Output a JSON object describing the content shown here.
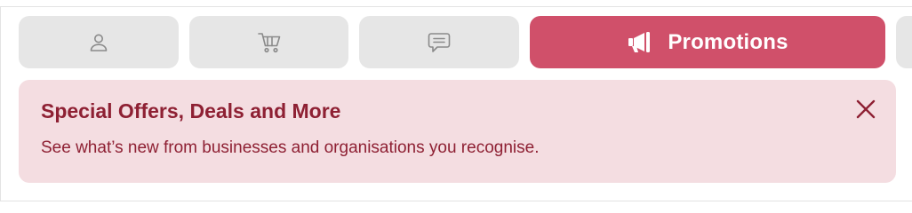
{
  "tabs": [
    {
      "icon": "person-icon",
      "label": ""
    },
    {
      "icon": "cart-icon",
      "label": ""
    },
    {
      "icon": "chat-bubble-icon",
      "label": ""
    },
    {
      "icon": "megaphone-icon",
      "label": "Promotions",
      "selected": true
    }
  ],
  "banner": {
    "title": "Special Offers, Deals and More",
    "text": "See what’s new from businesses and organisations you recognise.",
    "close_icon": "close-icon"
  },
  "colors": {
    "tab_inactive": "#e6e6e6",
    "tab_icon": "#8a8a8a",
    "accent": "#d0506a",
    "banner_bg": "#f4dde1",
    "banner_text": "#8e2033"
  }
}
